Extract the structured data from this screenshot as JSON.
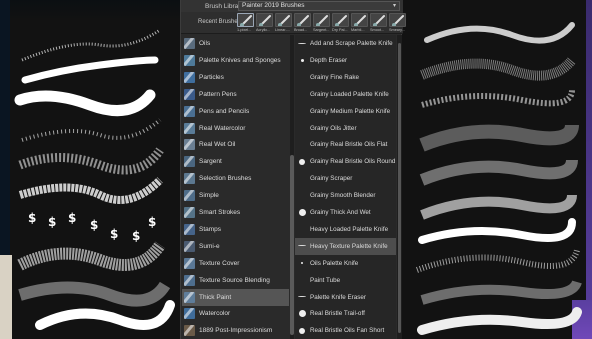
{
  "header": {
    "library_label": "Brush Library:",
    "library_value": "Painter 2019 Brushes",
    "recent_label": "Recent Brushes:"
  },
  "recent_brushes": [
    {
      "label": "1-pixel..."
    },
    {
      "label": "Acrylic..."
    },
    {
      "label": "Linear-..."
    },
    {
      "label": "Broad..."
    },
    {
      "label": "Sargent..."
    },
    {
      "label": "Dry Pal..."
    },
    {
      "label": "Marbli..."
    },
    {
      "label": "Smoot..."
    },
    {
      "label": "Smeary..."
    }
  ],
  "categories": [
    {
      "label": "Oils",
      "color": "#5a6c7e"
    },
    {
      "label": "Palette Knives and Sponges",
      "color": "#4e7a9a"
    },
    {
      "label": "Particles",
      "color": "#3f6e9e"
    },
    {
      "label": "Pattern Pens",
      "color": "#3a5a8a"
    },
    {
      "label": "Pens and Pencils",
      "color": "#4a6f93"
    },
    {
      "label": "Real Watercolor",
      "color": "#5a7c98"
    },
    {
      "label": "Real Wet Oil",
      "color": "#6a7e92"
    },
    {
      "label": "Sargent",
      "color": "#4a6680"
    },
    {
      "label": "Selection Brushes",
      "color": "#5c7890"
    },
    {
      "label": "Simple",
      "color": "#4e6c88"
    },
    {
      "label": "Smart Strokes",
      "color": "#557388"
    },
    {
      "label": "Stamps",
      "color": "#46648a"
    },
    {
      "label": "Sumi-e",
      "color": "#4a5a70"
    },
    {
      "label": "Texture Cover",
      "color": "#5a7896"
    },
    {
      "label": "Texture Source Blending",
      "color": "#4e6e8e"
    },
    {
      "label": "Thick Paint",
      "color": "#5f7d9a",
      "selected": true
    },
    {
      "label": "Watercolor",
      "color": "#3f6c9a"
    },
    {
      "label": "1889 Post-Impressionism",
      "color": "#6a5a48"
    }
  ],
  "variants": [
    {
      "label": "Add and Scrape Palette Knife",
      "marker": "dash"
    },
    {
      "label": "Depth Eraser",
      "marker": "dot",
      "size": 3
    },
    {
      "label": "Grainy Fine Rake",
      "marker": "none"
    },
    {
      "label": "Grainy Loaded Palette Knife",
      "marker": "none"
    },
    {
      "label": "Grainy Medium Palette Knife",
      "marker": "none"
    },
    {
      "label": "Grainy Oils Jitter",
      "marker": "none"
    },
    {
      "label": "Grainy Real Bristle Oils Flat",
      "marker": "none"
    },
    {
      "label": "Grainy Real Bristle Oils Round",
      "marker": "dot",
      "size": 6
    },
    {
      "label": "Grainy Scraper",
      "marker": "none"
    },
    {
      "label": "Grainy Smooth Blender",
      "marker": "none"
    },
    {
      "label": "Grainy Thick And Wet",
      "marker": "dot",
      "size": 7
    },
    {
      "label": "Heavy Loaded Palette Knife",
      "marker": "none"
    },
    {
      "label": "Heavy Texture Palette Knife",
      "marker": "dash",
      "selected": true
    },
    {
      "label": "Oils Palette Knife",
      "marker": "dot",
      "size": 2
    },
    {
      "label": "Paint Tube",
      "marker": "none"
    },
    {
      "label": "Palette Knife Eraser",
      "marker": "dash"
    },
    {
      "label": "Real Bristle Trail-off",
      "marker": "dot",
      "size": 7
    },
    {
      "label": "Real Bristle Oils Fan Short",
      "marker": "dot",
      "size": 6
    }
  ]
}
